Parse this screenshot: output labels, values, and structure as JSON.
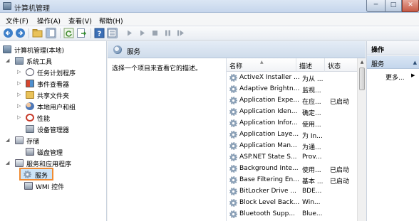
{
  "window": {
    "title": "计算机管理"
  },
  "window_buttons": [
    {
      "name": "minimize-button",
      "glyph": "─"
    },
    {
      "name": "maximize-button",
      "glyph": "□"
    },
    {
      "name": "close-button",
      "glyph": "✕"
    }
  ],
  "menu": [
    {
      "name": "menu-file",
      "label": "文件(F)"
    },
    {
      "name": "menu-action",
      "label": "操作(A)"
    },
    {
      "name": "menu-view",
      "label": "查看(V)"
    },
    {
      "name": "menu-help",
      "label": "帮助(H)"
    }
  ],
  "toolbar": {
    "items": [
      "back-icon",
      "forward-icon",
      "up-folder-icon",
      "show-hide-tree-icon",
      "refresh-icon",
      "export-icon",
      "help-icon",
      "properties-icon",
      "start-service-icon",
      "start-alt-icon",
      "stop-service-icon",
      "pause-service-icon",
      "restart-service-icon"
    ]
  },
  "tree": {
    "root": "计算机管理(本地)",
    "system_tools": "系统工具",
    "task_scheduler": "任务计划程序",
    "event_viewer": "事件查看器",
    "shared_folders": "共享文件夹",
    "local_users": "本地用户和组",
    "performance": "性能",
    "device_manager": "设备管理器",
    "storage": "存储",
    "disk_management": "磁盘管理",
    "services_apps": "服务和应用程序",
    "services": "服务",
    "wmi": "WMI 控件"
  },
  "center": {
    "header_title": "服务",
    "description_prompt": "选择一个项目来查看它的描述。",
    "columns": {
      "name": "名称",
      "desc": "描述",
      "status": "状态"
    },
    "rows": [
      {
        "name": "ActiveX Installer ...",
        "desc": "为从 ...",
        "status": ""
      },
      {
        "name": "Adaptive Brightn...",
        "desc": "监视...",
        "status": ""
      },
      {
        "name": "Application Expe...",
        "desc": "在应...",
        "status": "已启动"
      },
      {
        "name": "Application Iden...",
        "desc": "确定...",
        "status": ""
      },
      {
        "name": "Application Infor...",
        "desc": "使用...",
        "status": ""
      },
      {
        "name": "Application Laye...",
        "desc": "为 In...",
        "status": ""
      },
      {
        "name": "Application Man...",
        "desc": "为通...",
        "status": ""
      },
      {
        "name": "ASP.NET State S...",
        "desc": "Prov...",
        "status": ""
      },
      {
        "name": "Background Inte...",
        "desc": "使用...",
        "status": "已启动"
      },
      {
        "name": "Base Filtering En...",
        "desc": "基本 ...",
        "status": "已启动"
      },
      {
        "name": "BitLocker Drive ...",
        "desc": "BDE...",
        "status": ""
      },
      {
        "name": "Block Level Back...",
        "desc": "Win...",
        "status": ""
      },
      {
        "name": "Bluetooth Supp...",
        "desc": "Blue...",
        "status": ""
      }
    ]
  },
  "actions": {
    "header": "操作",
    "section": "服务",
    "more": "更多..."
  },
  "colors": {
    "selection_outline": "#f08c34",
    "selection_fill": "#cde4f7"
  }
}
